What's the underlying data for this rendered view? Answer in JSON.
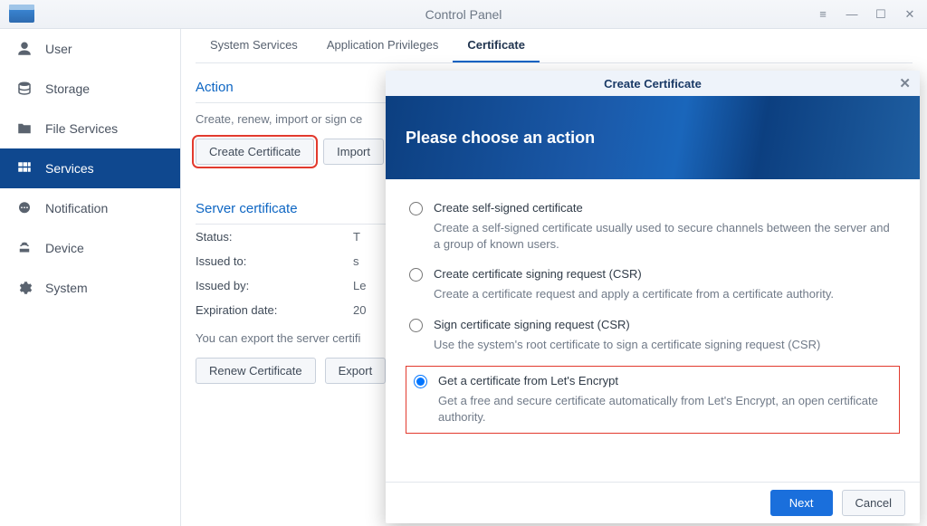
{
  "titlebar": {
    "title": "Control Panel"
  },
  "sidebar": {
    "items": [
      {
        "label": "User"
      },
      {
        "label": "Storage"
      },
      {
        "label": "File Services"
      },
      {
        "label": "Services"
      },
      {
        "label": "Notification"
      },
      {
        "label": "Device"
      },
      {
        "label": "System"
      }
    ]
  },
  "tabs": [
    {
      "label": "System Services"
    },
    {
      "label": "Application Privileges"
    },
    {
      "label": "Certificate"
    }
  ],
  "action": {
    "heading": "Action",
    "desc": "Create, renew, import or sign ce",
    "create_label": "Create Certificate",
    "import_label": "Import"
  },
  "server_cert": {
    "heading": "Server certificate",
    "status_k": "Status:",
    "status_v": "T",
    "issued_to_k": "Issued to:",
    "issued_to_v": "s",
    "issued_by_k": "Issued by:",
    "issued_by_v": "Le",
    "expiration_k": "Expiration date:",
    "expiration_v": "20",
    "note": "You can export the server certifi",
    "renew_label": "Renew Certificate",
    "export_label": "Export"
  },
  "modal": {
    "title": "Create Certificate",
    "hero": "Please choose an action",
    "options": [
      {
        "label": "Create self-signed certificate",
        "desc": "Create a self-signed certificate usually used to secure channels between the server and a group of known users."
      },
      {
        "label": "Create certificate signing request (CSR)",
        "desc": "Create a certificate request and apply a certificate from a certificate authority."
      },
      {
        "label": "Sign certificate signing request (CSR)",
        "desc": "Use the system's root certificate to sign a certificate signing request (CSR)"
      },
      {
        "label": "Get a certificate from Let's Encrypt",
        "desc": "Get a free and secure certificate automatically from Let's Encrypt, an open certificate authority."
      }
    ],
    "next": "Next",
    "cancel": "Cancel"
  }
}
